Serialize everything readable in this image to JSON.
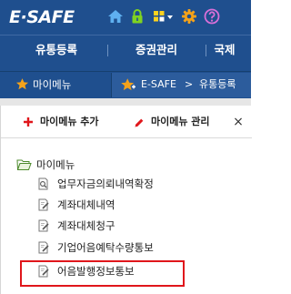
{
  "header": {
    "logo": "E·SAFE",
    "icons": [
      "home-icon",
      "lock-icon",
      "grid-menu-icon",
      "settings-icon",
      "help-icon"
    ]
  },
  "nav": {
    "items": [
      "유통등록",
      "증권관리",
      "국제"
    ]
  },
  "subnav": {
    "mymenu_label": "마이메뉴",
    "breadcrumb": [
      "E-SAFE",
      ">",
      "유통등록"
    ]
  },
  "panel": {
    "add_label": "마이메뉴 추가",
    "manage_label": "마이메뉴 관리",
    "close_label": "×"
  },
  "tree": {
    "root_label": "마이메뉴",
    "items": [
      {
        "label": "업무자금의뢰내역확정",
        "icon": "search-doc-icon"
      },
      {
        "label": "계좌대체내역",
        "icon": "edit-doc-icon"
      },
      {
        "label": "계좌대체청구",
        "icon": "edit-doc-icon"
      },
      {
        "label": "기업어음예탁수량통보",
        "icon": "edit-doc-icon"
      },
      {
        "label": "어음발행정보통보",
        "icon": "edit-doc-icon"
      }
    ]
  },
  "colors": {
    "header_bg": "#1f4f8e",
    "highlight": "#e0161b",
    "star": "#f4a21a",
    "lock": "#7fd321"
  }
}
